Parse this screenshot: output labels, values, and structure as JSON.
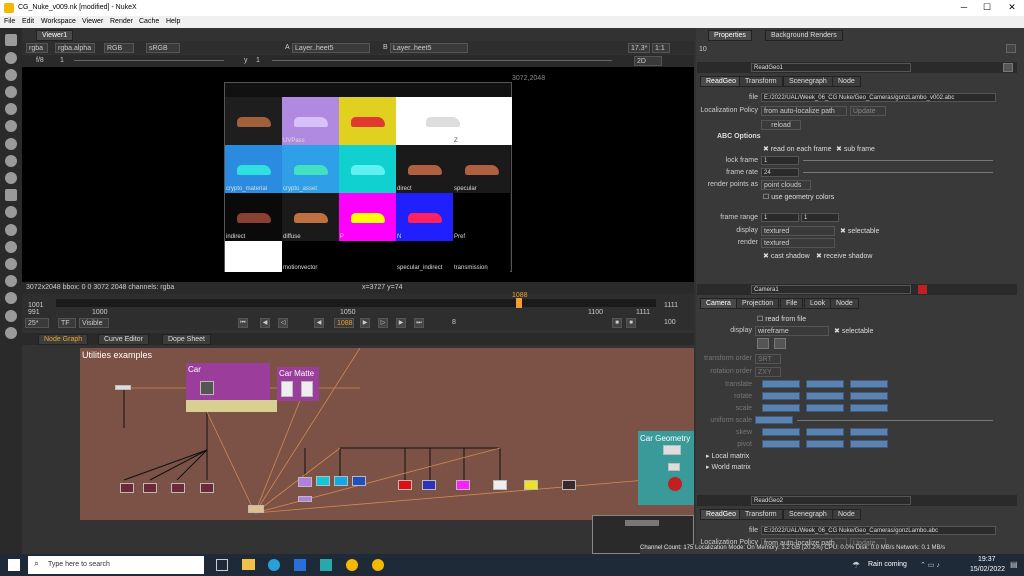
{
  "window": {
    "title": "CG_Nuke_v009.nk [modified] - NukeX"
  },
  "menu": [
    "File",
    "Edit",
    "Workspace",
    "Viewer",
    "Render",
    "Cache",
    "Help"
  ],
  "viewer_tab": "Viewer1",
  "viewer_toolbar": {
    "channels": "rgba",
    "alpha": "rgba.alpha",
    "rgb": "RGB",
    "colorspace": "sRGB",
    "input_a": "Layer..heet5",
    "input_b": "Layer..heet5",
    "gain": "17.3*",
    "ratio": "1:1",
    "fstop": "f/8",
    "frame_small": "1",
    "y_label": "y",
    "y_value": "1",
    "view_mode": "2D"
  },
  "viewer_overlay": {
    "resolution": "3072,2048"
  },
  "contact_sheet": {
    "labels": [
      "",
      "UVPass",
      "",
      "Z",
      "crypto_material",
      "crypto_asset",
      "",
      "direct",
      "specular",
      "indirect",
      "diffuse",
      "P",
      "N",
      "Pref",
      "",
      "motionvector",
      "",
      "specular_indirect",
      "transmission"
    ]
  },
  "viewer_info": {
    "bbox": "3072x2048 bbox: 0 0 3072 2048 channels: rgba",
    "coords": "x=3727 y=74"
  },
  "timeline": {
    "start": "1001",
    "end": "1111",
    "ticks": [
      "991",
      "1000",
      "1050",
      "1100",
      "1111"
    ],
    "current": "1088",
    "fps": "25*",
    "tf": "TF",
    "visible": "Visible",
    "frame": "1088",
    "inc": "8",
    "out": "100"
  },
  "node_tabs": [
    "Node Graph",
    "Curve Editor",
    "Dope Sheet"
  ],
  "backdrops": {
    "main": "Utilities examples",
    "car": "Car",
    "matte": "Car Matte",
    "geo": "Car Geometry"
  },
  "properties_tabs": [
    "Properties",
    "Background Renders"
  ],
  "properties_count": "10",
  "readgeo1": {
    "name": "ReadGeo1",
    "tabs": [
      "ReadGeo",
      "Transform",
      "Scenegraph",
      "Node"
    ],
    "file_label": "file",
    "file": "E:/2022/UAL/Week_06_CG Nuke/Geo_Cameras/gonzLambo_v002.abc",
    "loc_label": "Localization Policy",
    "loc": "from auto-localize path",
    "update": "Update",
    "reload": "reload",
    "abc_options": "ABC Options",
    "read_each": "read on each frame",
    "sub_frame": "sub frame",
    "lock_label": "lock frame",
    "lock": "1",
    "rate_label": "frame rate",
    "rate": "24",
    "points_label": "render points as",
    "points": "point clouds",
    "use_geo": "use geometry colors",
    "range_label": "frame range",
    "range_a": "1",
    "range_b": "1",
    "display_label": "display",
    "display": "textured",
    "selectable": "selectable",
    "render_label": "render",
    "render": "textured",
    "cast": "cast shadow",
    "receive": "receive shadow"
  },
  "camera1": {
    "name": "Camera1",
    "tabs": [
      "Camera",
      "Projection",
      "File",
      "Look",
      "Node"
    ],
    "read_file": "read from file",
    "display_label": "display",
    "display": "wireframe",
    "selectable": "selectable",
    "labels": [
      "transform order",
      "rotation order",
      "translate",
      "rotate",
      "scale",
      "uniform scale",
      "skew",
      "pivot"
    ],
    "transform_order": "SRT",
    "rotation_order": "ZXY",
    "local": "Local matrix",
    "world": "World matrix"
  },
  "readgeo2": {
    "name": "ReadGeo2",
    "tabs": [
      "ReadGeo",
      "Transform",
      "Scenegraph",
      "Node"
    ],
    "file_label": "file",
    "file": "E:/2022/UAL/Week_06_CG Nuke/Geo_Cameras/gonzLambo.abc",
    "loc_label": "Localization Policy",
    "loc": "from auto-localize path",
    "update": "Update"
  },
  "status": "Channel Count: 175 Localization Mode: On Memory: 3.2 GB (20.2%) CPU: 0.0% Disk: 0.0 MB/s Network: 0.1 MB/s",
  "taskbar": {
    "search": "Type here to search",
    "weather": "Rain coming",
    "time": "19:37",
    "date": "15/02/2022"
  },
  "colors": {
    "backdrop": "#7b5245",
    "car": "#9b3e9b",
    "geo": "#3a9a9a",
    "timeline_marker": "#f0a030"
  }
}
